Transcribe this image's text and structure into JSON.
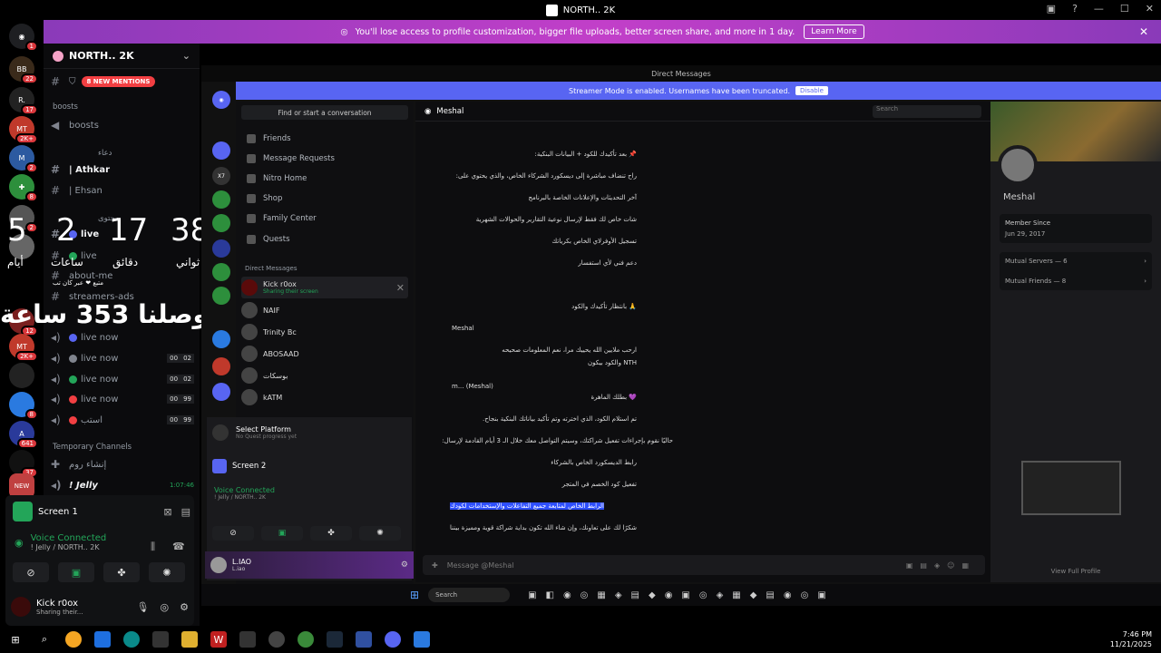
{
  "window": {
    "title": "NORTH.. 2K"
  },
  "promo": {
    "text": "You'll lose access to profile customization, bigger file uploads, better screen share, and more in 1 day.",
    "button": "Learn More"
  },
  "guild": {
    "name": "NORTH.. 2K",
    "mentions": "8 NEW MENTIONS"
  },
  "channels": {
    "boosts_cat": "boosts",
    "boosts": "boosts",
    "cat2": "دعاء",
    "athkar": "| Athkar",
    "ehsan": "| Ehsan",
    "cat3": "محتوى",
    "live1": "live",
    "live2": "live",
    "about": "about-me",
    "ads": "streamers-ads",
    "v1": "live now",
    "v2": "live now",
    "v3": "live now",
    "v4": "live now",
    "v5": "استب",
    "c1a": "00",
    "c1b": "02",
    "c2a": "00",
    "c2b": "02",
    "c3a": "00",
    "c3b": "99",
    "c4a": "00",
    "c4b": "99",
    "temp_cat": "Temporary Channels",
    "create": "إنشاء روم",
    "jelly": "! Jelly",
    "jelly_time": "1:07:46"
  },
  "overlay": {
    "n1": "5",
    "n2": "2",
    "n3": "17",
    "n4": "38",
    "l1": "أيام",
    "l2": "ساعات",
    "l3": "دقائق",
    "l4": "ثواني",
    "small": "متبع ❤ عبر كان تب",
    "line": "حاليًا وصلنا 353 ساعة"
  },
  "left_panel": {
    "screen": "Screen 1",
    "vc": "Voice Connected",
    "vc_sub": "! Jelly / NORTH.. 2K",
    "user": "Kick r0ox",
    "user_status": "Sharing their..."
  },
  "stream": {
    "top_title": "Direct Messages",
    "streamer": "Streamer Mode is enabled. Usernames have been truncated.",
    "disable": "Disable",
    "search": "Find or start a conversation",
    "nav": [
      "Friends",
      "Message Requests",
      "Nitro Home",
      "Shop",
      "Family Center",
      "Quests"
    ],
    "dm_label": "Direct Messages",
    "dms": [
      {
        "name": "Kick r0ox",
        "sub": "Sharing their screen"
      },
      {
        "name": "NAIF",
        "sub": ""
      },
      {
        "name": "Trinity Bc",
        "sub": ""
      },
      {
        "name": "ABOSAAD",
        "sub": ""
      },
      {
        "name": "بوسكات",
        "sub": ""
      },
      {
        "name": "kATM",
        "sub": ""
      }
    ],
    "select_platform": "Select Platform",
    "no_quest": "No Quest progress yet",
    "screen2": "Screen 2",
    "vc": "Voice Connected",
    "vc_sub": "! Jelly / NORTH.. 2K",
    "me": "L.IAO",
    "me_sub": "L.iao",
    "chat_title": "Meshal",
    "chat_search": "Search",
    "messages": [
      "📌 بعد تأكيدك للكود + البيانات البنكية:",
      "راح تنضاف مباشرة إلى ديسكورد الشركاء الخاص، والذي يحتوي على:",
      "آخر التحديثات والإعلانات الخاصة بالبرنامج",
      "شات خاص لك فقط لإرسال نوعية التقارير والحوالات الشهرية",
      "تسجيل الأوفرلاي الخاص بكرياتك",
      "دعم فني لأي استفسار",
      "🙏 بانتظار تأكيدك والكود",
      "Meshal",
      "ارحب ملايين الله يحييك مرا، نعم المعلومات صحيحه",
      "NTH والكود بيكون",
      "m... (Meshal)",
      "💜 بطلك الماهرة",
      "تم استلام الكود، الذي اخترته وتم تأكيد بياناتك البنكية بنجاح.",
      "حاليًا نقوم بإجراءات تفعيل شراكتك، وسيتم التواصل معك خلال الـ 3 أيام القادمة لإرسال:",
      "رابط الديسكورد الخاص بالشركاء",
      "تفعيل كود الخصم في المتجر",
      "الرابط الخاص لمتابعة جميع التفاعلات والإستخدامات لكودك",
      "شكرًا لك على تعاونك، وإن شاء الله تكون بداية شراكة قوية ومميزة بيننا"
    ],
    "input": "Message @Meshal",
    "profile": {
      "name": "Meshal",
      "since_label": "Member Since",
      "since": "Jun 29, 2017",
      "servers": "Mutual Servers — 6",
      "friends": "Mutual Friends — 8",
      "view": "View Full Profile"
    },
    "taskbar_search": "Search"
  },
  "tray": {
    "time": "7:46 PM",
    "date": "11/21/2025"
  }
}
